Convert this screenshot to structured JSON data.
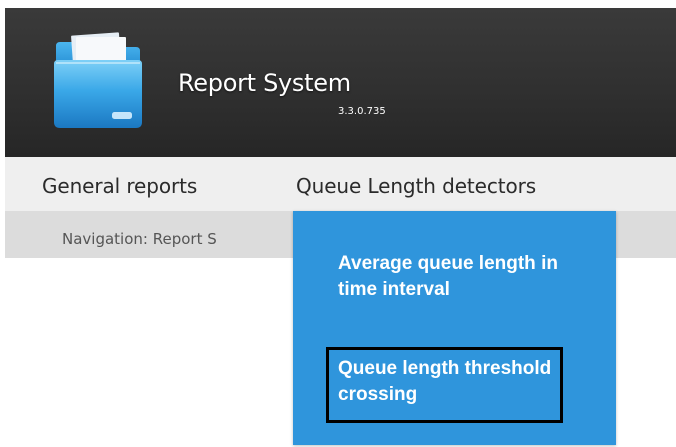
{
  "app": {
    "title": "Report System",
    "version": "3.3.0.735",
    "logo_icon": "folder-icon"
  },
  "menu": {
    "items": [
      {
        "label": "General reports"
      },
      {
        "label": "Queue Length detectors"
      }
    ]
  },
  "navigation": {
    "text": "Navigation: Report S"
  },
  "dropdown": {
    "items": [
      {
        "label": "Average queue length in time interval"
      },
      {
        "label": "Queue length threshold crossing"
      }
    ],
    "highlighted_index": 1
  },
  "colors": {
    "header_bg": "#2f2f2f",
    "menubar_bg": "#efefef",
    "navbar_bg": "#dcdcdc",
    "dropdown_bg": "#2f95dc",
    "highlight_border": "#000000"
  }
}
